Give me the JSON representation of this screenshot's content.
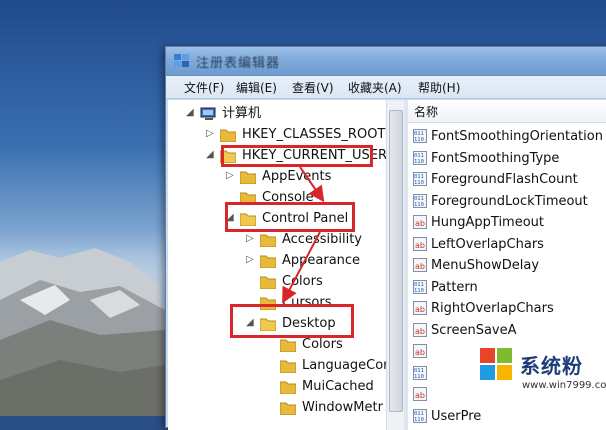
{
  "window": {
    "title": "注册表编辑器"
  },
  "menubar": {
    "items": [
      {
        "label": "文件(F)"
      },
      {
        "label": "编辑(E)"
      },
      {
        "label": "查看(V)"
      },
      {
        "label": "收藏夹(A)"
      },
      {
        "label": "帮助(H)"
      }
    ]
  },
  "tree": {
    "root": "计算机",
    "nodes": [
      {
        "label": "HKEY_CLASSES_ROOT"
      },
      {
        "label": "HKEY_CURRENT_USER"
      },
      {
        "label": "AppEvents"
      },
      {
        "label": "Console"
      },
      {
        "label": "Control Panel"
      },
      {
        "label": "Accessibility"
      },
      {
        "label": "Appearance"
      },
      {
        "label": "Colors"
      },
      {
        "label": "Cursors"
      },
      {
        "label": "Desktop"
      },
      {
        "label": "Colors"
      },
      {
        "label": "LanguageCor"
      },
      {
        "label": "MuiCached"
      },
      {
        "label": "WindowMetr"
      }
    ]
  },
  "values": {
    "header": "名称",
    "rows": [
      {
        "name": "FontSmoothingOrientation",
        "type": "binary"
      },
      {
        "name": "FontSmoothingType",
        "type": "binary"
      },
      {
        "name": "ForegroundFlashCount",
        "type": "binary"
      },
      {
        "name": "ForegroundLockTimeout",
        "type": "binary"
      },
      {
        "name": "HungAppTimeout",
        "type": "string"
      },
      {
        "name": "LeftOverlapChars",
        "type": "string"
      },
      {
        "name": "MenuShowDelay",
        "type": "string"
      },
      {
        "name": "Pattern",
        "type": "binary"
      },
      {
        "name": "RightOverlapChars",
        "type": "string"
      },
      {
        "name": "ScreenSaveA",
        "type": "string"
      },
      {
        "name": "",
        "type": "string"
      },
      {
        "name": "",
        "type": "binary"
      },
      {
        "name": "",
        "type": "string"
      },
      {
        "name": "UserPre",
        "type": "binary"
      }
    ]
  },
  "watermark": {
    "brand": "系统粉",
    "url": "www.win7999.com"
  },
  "colors": {
    "annotation": "#d8262a",
    "folder": "#e8b93a"
  }
}
